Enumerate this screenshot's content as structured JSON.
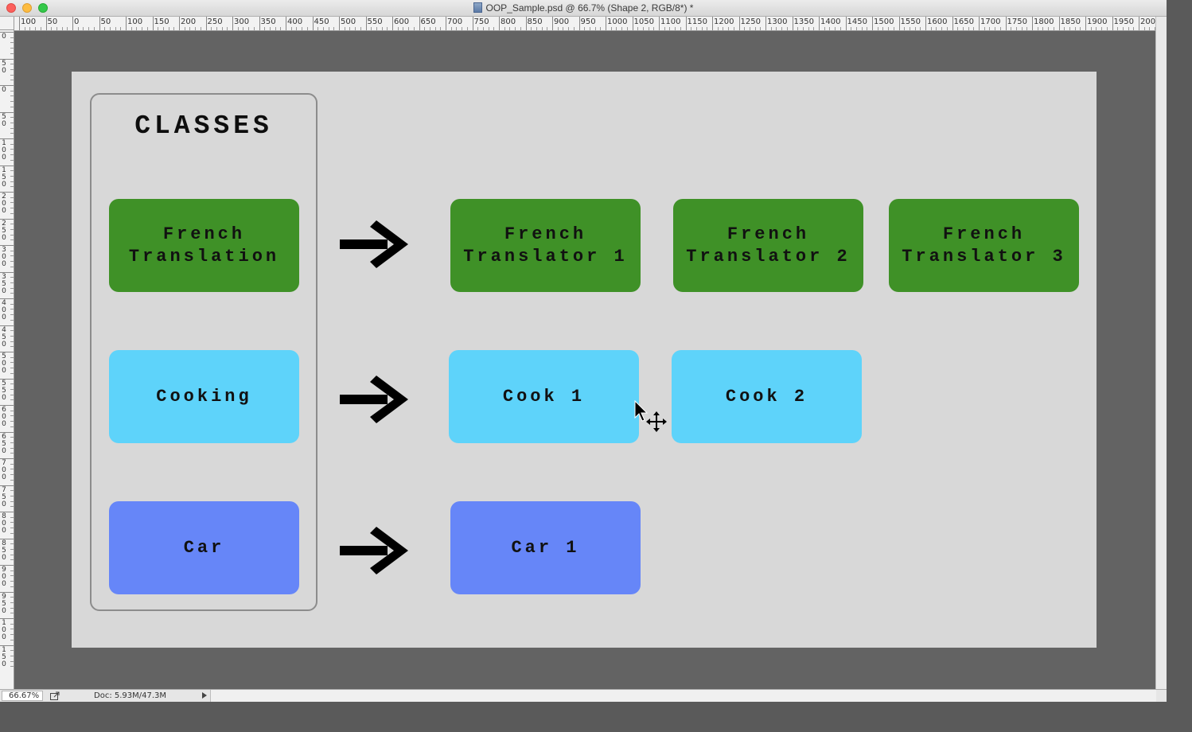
{
  "window": {
    "title": "OOP_Sample.psd @ 66.7% (Shape 2, RGB/8*) *"
  },
  "ruler_top_labels": [
    "100",
    "50",
    "0",
    "50",
    "100",
    "150",
    "200",
    "250",
    "300",
    "350",
    "400",
    "450",
    "500",
    "550",
    "600",
    "650",
    "700",
    "750",
    "800",
    "850",
    "900",
    "950",
    "1000",
    "1050",
    "1100",
    "1150",
    "1200",
    "1250",
    "1300",
    "1350",
    "1400",
    "1450",
    "1500",
    "1550",
    "1600",
    "1650",
    "1700",
    "1750",
    "1800",
    "1850",
    "1900",
    "1950",
    "200"
  ],
  "ruler_left_labels": [
    "0",
    "50",
    "0",
    "50",
    "100",
    "150",
    "200",
    "250",
    "300",
    "350",
    "400",
    "450",
    "500",
    "550",
    "600",
    "650",
    "700",
    "750",
    "800",
    "850",
    "900",
    "950",
    "100",
    "150"
  ],
  "diagram": {
    "classes_title": "CLASSES",
    "classes": [
      {
        "label": "French\nTranslation",
        "color": "#3f9127"
      },
      {
        "label": "Cooking",
        "color": "#5ed3fa"
      },
      {
        "label": "Car",
        "color": "#6686f8"
      }
    ],
    "instances": {
      "french": [
        "French\nTranslator 1",
        "French\nTranslator 2",
        "French\nTranslator 3"
      ],
      "cook": [
        "Cook 1",
        "Cook 2"
      ],
      "car": [
        "Car 1"
      ]
    }
  },
  "status": {
    "zoom": "66.67%",
    "doc_info": "Doc: 5.93M/47.3M"
  },
  "icons": {
    "share": "share-export-icon",
    "cursor": "move-tool-cursor-icon"
  }
}
